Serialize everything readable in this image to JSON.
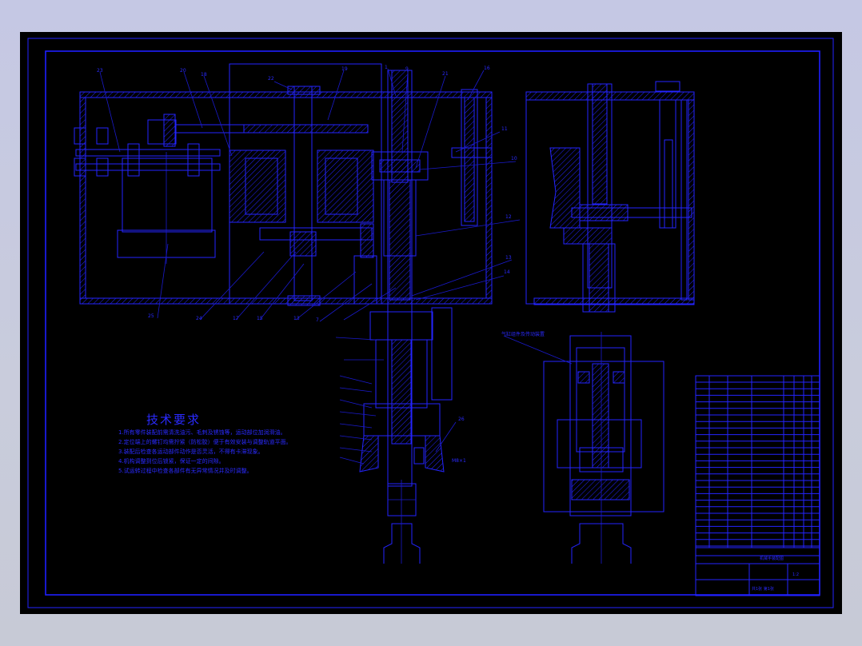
{
  "drawing": {
    "tech_requirements": {
      "title": "技术要求",
      "lines": [
        "1.所有零件装配前需清洗油污、毛刺及锈蚀等，运动部位加润滑油。",
        "2.定位端上的螺钉均需拧紧（防松胶）便于有效安装与调整轨道平面。",
        "3.装配后检查各运动部件动作是否灵活，不得有卡滞现象。",
        "4.机构调整到位后锁紧，保证一定的间隙。",
        "5.试运转过程中检查各部件有无异常情况并及时调整。"
      ]
    },
    "callout_label": "M8×1",
    "note_label": "气缸组件及传动装置",
    "title_block": {
      "drawing_title": "机械手装配图",
      "scale": "1:2",
      "sheet": "共1张 第1张"
    }
  },
  "colors": {
    "background": "#000000",
    "line": "#2424ff",
    "frame": "#1e1eff",
    "outer": "#c7cad6"
  }
}
